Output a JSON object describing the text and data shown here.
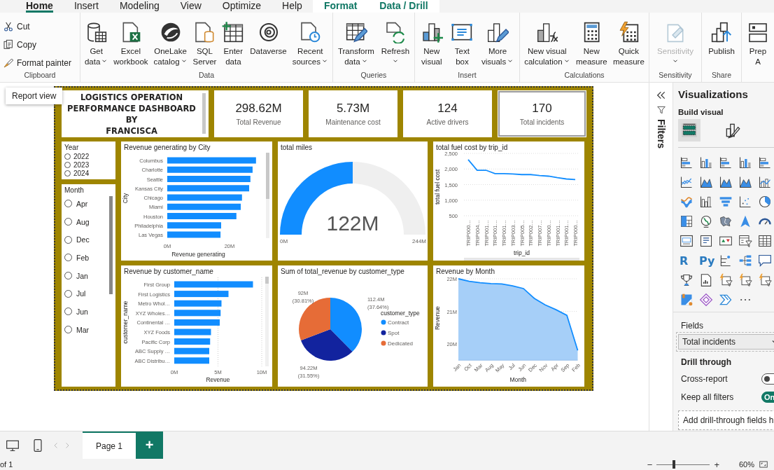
{
  "tabs": [
    {
      "label": "Home",
      "selected": true,
      "kind": "main"
    },
    {
      "label": "Insert",
      "selected": false,
      "kind": "main"
    },
    {
      "label": "Modeling",
      "selected": false,
      "kind": "main"
    },
    {
      "label": "View",
      "selected": false,
      "kind": "main"
    },
    {
      "label": "Optimize",
      "selected": false,
      "kind": "main"
    },
    {
      "label": "Help",
      "selected": false,
      "kind": "main"
    },
    {
      "label": "Format",
      "selected": false,
      "kind": "contextual"
    },
    {
      "label": "Data / Drill",
      "selected": false,
      "kind": "contextual"
    }
  ],
  "ribbon": {
    "groups": [
      {
        "label": "Clipboard",
        "kind": "small",
        "buttons": [
          {
            "lines": [
              "Cut"
            ],
            "dropdown": false,
            "disabled": false
          },
          {
            "lines": [
              "Copy"
            ],
            "dropdown": false,
            "disabled": false
          },
          {
            "lines": [
              "Format painter"
            ],
            "dropdown": false,
            "disabled": false
          }
        ]
      },
      {
        "label": "Data",
        "kind": "large",
        "buttons": [
          {
            "lines": [
              "Get",
              "data"
            ],
            "dropdown": true,
            "disabled": false
          },
          {
            "lines": [
              "Excel",
              "workbook"
            ],
            "dropdown": false,
            "disabled": false
          },
          {
            "lines": [
              "OneLake",
              "catalog"
            ],
            "dropdown": true,
            "disabled": false
          },
          {
            "lines": [
              "SQL",
              "Server"
            ],
            "dropdown": false,
            "disabled": false
          },
          {
            "lines": [
              "Enter",
              "data"
            ],
            "dropdown": false,
            "disabled": false
          },
          {
            "lines": [
              "Dataverse"
            ],
            "dropdown": false,
            "disabled": false
          },
          {
            "lines": [
              "Recent",
              "sources"
            ],
            "dropdown": true,
            "disabled": false
          }
        ]
      },
      {
        "label": "Queries",
        "kind": "large",
        "buttons": [
          {
            "lines": [
              "Transform",
              "data"
            ],
            "dropdown": true,
            "disabled": false
          },
          {
            "lines": [
              "Refresh"
            ],
            "dropdown": true,
            "disabled": false
          }
        ]
      },
      {
        "label": "Insert",
        "kind": "large",
        "buttons": [
          {
            "lines": [
              "New",
              "visual"
            ],
            "dropdown": false,
            "disabled": false
          },
          {
            "lines": [
              "Text",
              "box"
            ],
            "dropdown": false,
            "disabled": false
          },
          {
            "lines": [
              "More",
              "visuals"
            ],
            "dropdown": true,
            "disabled": false
          }
        ]
      },
      {
        "label": "Calculations",
        "kind": "large",
        "buttons": [
          {
            "lines": [
              "New visual",
              "calculation"
            ],
            "dropdown": true,
            "disabled": false
          },
          {
            "lines": [
              "New",
              "measure"
            ],
            "dropdown": false,
            "disabled": false
          },
          {
            "lines": [
              "Quick",
              "measure"
            ],
            "dropdown": false,
            "disabled": false
          }
        ]
      },
      {
        "label": "Sensitivity",
        "kind": "large",
        "buttons": [
          {
            "lines": [
              "Sensitivity"
            ],
            "dropdown": true,
            "disabled": true
          }
        ]
      },
      {
        "label": "Share",
        "kind": "large",
        "buttons": [
          {
            "lines": [
              "Publish"
            ],
            "dropdown": false,
            "disabled": false
          }
        ]
      },
      {
        "kind": "large",
        "buttons": [
          {
            "lines": [
              "Prep",
              "A"
            ],
            "dropdown": false,
            "disabled": false
          }
        ]
      }
    ]
  },
  "tooltip": "Report view",
  "report": {
    "title": "LOGISTICS OPERATION\nPERFORMANCE DASHBOARD\nBY\nFRANCISCA",
    "kpis": [
      {
        "value": "298.62M",
        "label": "Total Revenue",
        "selected": false
      },
      {
        "value": "5.73M",
        "label": "Maintenance cost",
        "selected": false
      },
      {
        "value": "124",
        "label": "Active drivers",
        "selected": false
      },
      {
        "value": "170",
        "label": "Total incidents",
        "selected": true
      }
    ],
    "slicers": [
      {
        "title": "Year",
        "items": [
          {
            "label": "2022",
            "selected": false
          },
          {
            "label": "2023",
            "selected": false
          },
          {
            "label": "2024",
            "selected": false
          }
        ]
      },
      {
        "title": "Month",
        "items": [
          {
            "label": "Apr",
            "selected": false
          },
          {
            "label": "Aug",
            "selected": false
          },
          {
            "label": "Dec",
            "selected": false
          },
          {
            "label": "Feb",
            "selected": false
          },
          {
            "label": "Jan",
            "selected": false
          },
          {
            "label": "Jul",
            "selected": false
          },
          {
            "label": "Jun",
            "selected": false
          },
          {
            "label": "Mar",
            "selected": false
          }
        ]
      }
    ],
    "visuals": [
      {
        "chart_data": {
          "type": "bar",
          "orientation": "horizontal",
          "title": "Revenue generating by City",
          "xlabel": "Revenue generating",
          "ylabel": "City",
          "categories": [
            "Columbus",
            "Charlotte",
            "Seattle",
            "Kansas City",
            "Chicago",
            "Miami",
            "Houston",
            "Philadelphia",
            "Las Vegas"
          ],
          "series": [
            {
              "color": "#118dff",
              "values": [
                28.5,
                27.4,
                26.7,
                26.3,
                24.0,
                23.6,
                22.2,
                17.3,
                17.1
              ]
            }
          ],
          "xlim": [
            0,
            32
          ],
          "xticks": [
            {
              "value": 0,
              "label": "0M"
            },
            {
              "value": 20,
              "label": "20M"
            }
          ]
        }
      },
      {
        "kind": "gauge",
        "title": "total miles",
        "value": "122M",
        "min": "0M",
        "max": "244M",
        "level": 0.5
      },
      {
        "chart_data": {
          "type": "line",
          "title": "total fuel cost by trip_id",
          "xlabel": "trip_id",
          "ylabel": "total fuel cost",
          "categories": [
            "TRIP000…",
            "TRIP004…",
            "TRIP001…",
            "TRIP001…",
            "TRIP001…",
            "TRIP003…",
            "TRIP005…",
            "TRIP002…",
            "TRIP007…",
            "TRIP000…",
            "TRIP001…",
            "TRIP001…",
            "TRIP000…"
          ],
          "series": [
            {
              "color": "#118dff",
              "values": [
                2300,
                1960,
                1960,
                1850,
                1850,
                1840,
                1820,
                1820,
                1790,
                1770,
                1720,
                1680,
                1660
              ]
            }
          ],
          "grid": true,
          "ylim": [
            500,
            2500
          ],
          "yticks": [
            {
              "value": 500,
              "label": "500"
            },
            {
              "value": 1000,
              "label": "1,000"
            },
            {
              "value": 1500,
              "label": "1,500"
            },
            {
              "value": 2000,
              "label": "2,000"
            },
            {
              "value": 2500,
              "label": "2,500"
            }
          ]
        }
      },
      {
        "chart_data": {
          "type": "bar",
          "orientation": "horizontal",
          "title": "Revenue by customer_name",
          "xlabel": "Revenue",
          "ylabel": "customer_name",
          "categories": [
            "First Group",
            "First Logistics",
            "Metro Whol…",
            "XYZ Wholes…",
            "Continental …",
            "XYZ Foods",
            "Pacific Corp",
            "ABC Supply …",
            "ABC Distribu…"
          ],
          "series": [
            {
              "color": "#118dff",
              "values": [
                9.0,
                6.2,
                5.4,
                5.3,
                5.2,
                4.2,
                4.1,
                4.0,
                4.0
              ]
            }
          ],
          "grid": true,
          "xlim": [
            0,
            10
          ],
          "xticks": [
            {
              "value": 0,
              "label": "0M"
            },
            {
              "value": 5,
              "label": "5M"
            },
            {
              "value": 10,
              "label": "10M"
            }
          ]
        }
      },
      {
        "chart_data": {
          "type": "pie",
          "title": "Sum of total_revenue by customer_type",
          "legend_title": "customer_type",
          "categories": [
            "Contract",
            "Spot",
            "Dedicated"
          ],
          "colors": [
            "#118dff",
            "#12239e",
            "#e66c37"
          ],
          "legend": "right",
          "series": [
            {
              "values": [
                37.64,
                31.55,
                30.81
              ]
            }
          ],
          "value_labels": [
            [
              "112.4M",
              "(37.64%)"
            ],
            [
              "94.22M",
              "(31.55%)"
            ],
            [
              "92M",
              "(30.81%)"
            ]
          ]
        }
      },
      {
        "chart_data": {
          "type": "area",
          "title": "Revenue by Month",
          "xlabel": "Month",
          "ylabel": "Revenue",
          "categories": [
            "Jan",
            "Oct",
            "Mar",
            "Aug",
            "May",
            "Jul",
            "Jun",
            "Dec",
            "Nov",
            "Apr",
            "Sep",
            "Feb"
          ],
          "series": [
            {
              "color": "#118dff",
              "values": [
                22.0,
                21.92,
                21.88,
                21.85,
                21.84,
                21.78,
                21.7,
                21.4,
                21.2,
                21.05,
                20.88,
                19.8
              ]
            }
          ],
          "grid": true,
          "ylim": [
            19.5,
            22
          ],
          "yticks": [
            {
              "value": 20,
              "label": "20M"
            },
            {
              "value": 21,
              "label": "21M"
            },
            {
              "value": 22,
              "label": "22M"
            }
          ]
        }
      }
    ]
  },
  "filters_pane": {
    "label": "Filters"
  },
  "visualizations": {
    "title": "Visualizations",
    "subtitle": "Build visual",
    "tabs": [
      {
        "selected": true
      },
      {
        "selected": false
      }
    ],
    "letter_icons": [
      "R",
      "Py"
    ],
    "fields_label": "Fields",
    "field_value": "Total incidents",
    "drill_title": "Drill through",
    "toggles": [
      {
        "label": "Cross-report",
        "on": false
      },
      {
        "label": "Keep all filters",
        "on": true,
        "state_text": "On"
      }
    ],
    "drop_hint": "Add drill-through fields h"
  },
  "pages": [
    {
      "label": "Page 1",
      "selected": true
    }
  ],
  "add_page": "+",
  "status": {
    "page_text": "of 1",
    "zoom": {
      "minus": "−",
      "plus": "+",
      "level": 0.32,
      "reading": "60%"
    }
  }
}
